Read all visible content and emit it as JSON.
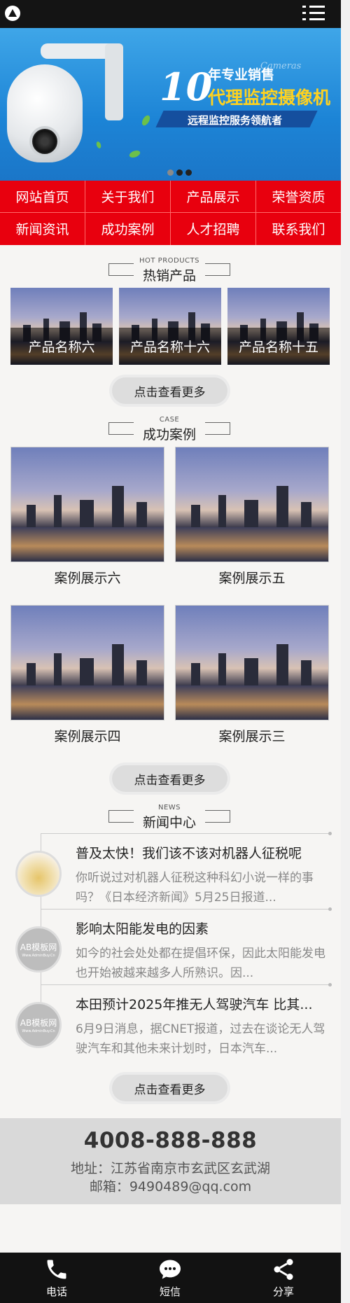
{
  "header": {
    "logo": "logo-icon",
    "menu": "menu-icon"
  },
  "banner": {
    "num": "10",
    "line1": "年专业销售",
    "cameras": "Cameras",
    "line2": "代理监控摄像机",
    "line3": "远程监控服务领航者",
    "slide_count": 3,
    "active_slide": 1
  },
  "nav": {
    "items": [
      "网站首页",
      "关于我们",
      "产品展示",
      "荣誉资质",
      "新闻资讯",
      "成功案例",
      "人才招聘",
      "联系我们"
    ]
  },
  "products": {
    "en": "HOT PRODUCTS",
    "title": "热销产品",
    "items": [
      "产品名称六",
      "产品名称十六",
      "产品名称十五"
    ],
    "more": "点击查看更多"
  },
  "cases": {
    "en": "CASE",
    "title": "成功案例",
    "items": [
      "案例展示六",
      "案例展示五",
      "案例展示四",
      "案例展示三"
    ],
    "more": "点击查看更多"
  },
  "news": {
    "en": "NEWS",
    "title": "新闻中心",
    "items": [
      {
        "title": "普及太快！我们该不该对机器人征税呢",
        "desc": "你听说过对机器人征税这种科幻小说一样的事吗？《日本经济新闻》5月25日报道...",
        "thumb_text": "",
        "thumb_sub": ""
      },
      {
        "title": "影响太阳能发电的因素",
        "desc": "如今的社会处处都在提倡环保，因此太阳能发电也开始被越来越多人所熟识。因...",
        "thumb_text": "AB模板网",
        "thumb_sub": "Www.AdminBuy.Cn"
      },
      {
        "title": "本田预计2025年推无人驾驶汽车 比其...",
        "desc": "6月9日消息，据CNET报道，过去在谈论无人驾驶汽车和其他未来计划时，日本汽车...",
        "thumb_text": "AB模板网",
        "thumb_sub": "Www.AdminBuy.Cn"
      }
    ],
    "more": "点击查看更多"
  },
  "contact": {
    "tel": "4008-888-888",
    "address": "地址：江苏省南京市玄武区玄武湖",
    "email": "邮箱：9490489@qq.com"
  },
  "footer": {
    "items": [
      {
        "label": "电话",
        "icon": "phone-icon"
      },
      {
        "label": "短信",
        "icon": "message-icon"
      },
      {
        "label": "分享",
        "icon": "share-icon"
      }
    ]
  },
  "colors": {
    "brand_red": "#e8000e",
    "topbar": "#141414",
    "accent_yellow": "#ffd21f"
  }
}
